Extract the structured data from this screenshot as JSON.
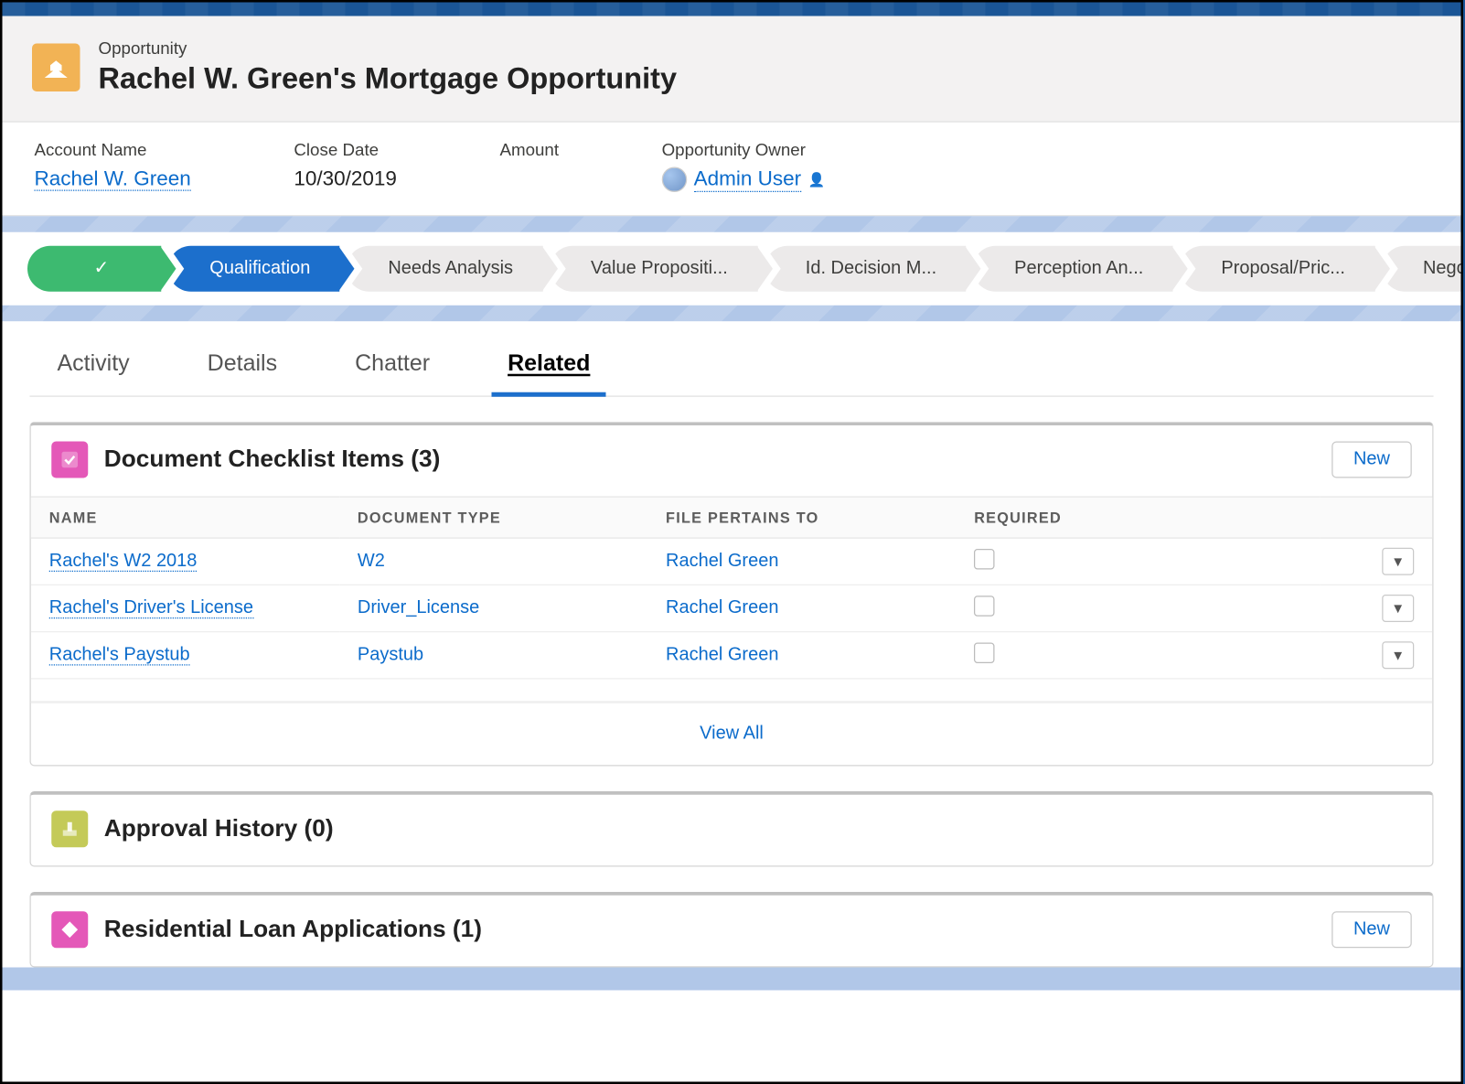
{
  "header": {
    "object_label": "Opportunity",
    "title": "Rachel W. Green's Mortgage Opportunity"
  },
  "highlights": {
    "account_name": {
      "label": "Account Name",
      "value": "Rachel W. Green"
    },
    "close_date": {
      "label": "Close Date",
      "value": "10/30/2019"
    },
    "amount": {
      "label": "Amount",
      "value": ""
    },
    "owner": {
      "label": "Opportunity Owner",
      "value": "Admin User"
    }
  },
  "path": {
    "stages": [
      {
        "label": "",
        "state": "complete",
        "check": true
      },
      {
        "label": "Qualification",
        "state": "current"
      },
      {
        "label": "Needs Analysis",
        "state": "incomplete"
      },
      {
        "label": "Value Propositi...",
        "state": "incomplete"
      },
      {
        "label": "Id. Decision M...",
        "state": "incomplete"
      },
      {
        "label": "Perception An...",
        "state": "incomplete"
      },
      {
        "label": "Proposal/Pric...",
        "state": "incomplete"
      },
      {
        "label": "Nego",
        "state": "incomplete"
      }
    ]
  },
  "tabs": [
    {
      "label": "Activity",
      "active": false
    },
    {
      "label": "Details",
      "active": false
    },
    {
      "label": "Chatter",
      "active": false
    },
    {
      "label": "Related",
      "active": true
    }
  ],
  "doc_checklist": {
    "title": "Document Checklist Items (3)",
    "new_label": "New",
    "columns": [
      "NAME",
      "DOCUMENT TYPE",
      "FILE PERTAINS TO",
      "REQUIRED"
    ],
    "rows": [
      {
        "name": "Rachel's W2 2018",
        "type": "W2",
        "pertains": "Rachel Green",
        "required": false
      },
      {
        "name": "Rachel's Driver's License",
        "type": "Driver_License",
        "pertains": "Rachel Green",
        "required": false
      },
      {
        "name": "Rachel's Paystub",
        "type": "Paystub",
        "pertains": "Rachel Green",
        "required": false
      }
    ],
    "view_all": "View All"
  },
  "approval_history": {
    "title": "Approval History (0)"
  },
  "loan_apps": {
    "title": "Residential Loan Applications (1)",
    "new_label": "New"
  }
}
